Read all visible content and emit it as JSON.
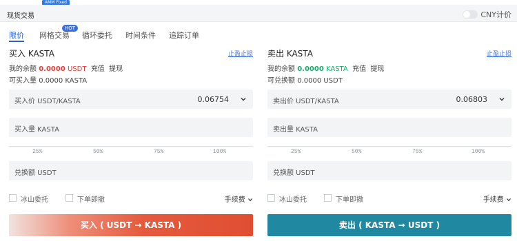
{
  "top": {
    "amm_badge": "AMM Fixed"
  },
  "header": {
    "title": "现货交易",
    "cny_label": "CNY计价"
  },
  "tabs": [
    {
      "label": "限价"
    },
    {
      "label": "网格交易",
      "badge": "HOT"
    },
    {
      "label": "循环委托"
    },
    {
      "label": "时间条件"
    },
    {
      "label": "追踪订单"
    }
  ],
  "buy": {
    "title": "买入 KASTA",
    "stop_link": "止盈止损",
    "balance_label": "我的余额",
    "balance_value": "0.0000",
    "balance_unit": "USDT",
    "deposit": "充值",
    "withdraw": "提现",
    "can_label": "可买入量",
    "can_value": "0.0000",
    "can_unit": "KASTA",
    "price_label": "买入价 USDT/KASTA",
    "price_value": "0.06754",
    "amount_label": "买入量 KASTA",
    "total_label": "兑换额 USDT",
    "iceberg": "冰山委托",
    "ioc": "下单即撤",
    "fee": "手续费",
    "button": "买入 ( USDT  →  KASTA )"
  },
  "sell": {
    "title": "卖出 KASTA",
    "stop_link": "止盈止损",
    "balance_label": "我的余额",
    "balance_value": "0.0000",
    "balance_unit": "KASTA",
    "deposit": "充值",
    "withdraw": "提现",
    "can_label": "可兑换额",
    "can_value": "0.0000",
    "can_unit": "USDT",
    "price_label": "卖出价 USDT/KASTA",
    "price_value": "0.06803",
    "amount_label": "卖出量 KASTA",
    "total_label": "兑换额 USDT",
    "iceberg": "冰山委托",
    "ioc": "下单即撤",
    "fee": "手续费",
    "button": "卖出 ( KASTA  →  USDT )"
  },
  "slider_marks": [
    "25%",
    "50%",
    "75%",
    "100%"
  ],
  "colors": {
    "accent": "#2f62c9",
    "buy": "#e04e31",
    "sell": "#2089a1",
    "red_value": "#e23b3b",
    "green_value": "#1aaa6a"
  },
  "icons": {
    "chevron": "chevron-down-icon",
    "fee_chevron": "chevron-down-icon"
  }
}
